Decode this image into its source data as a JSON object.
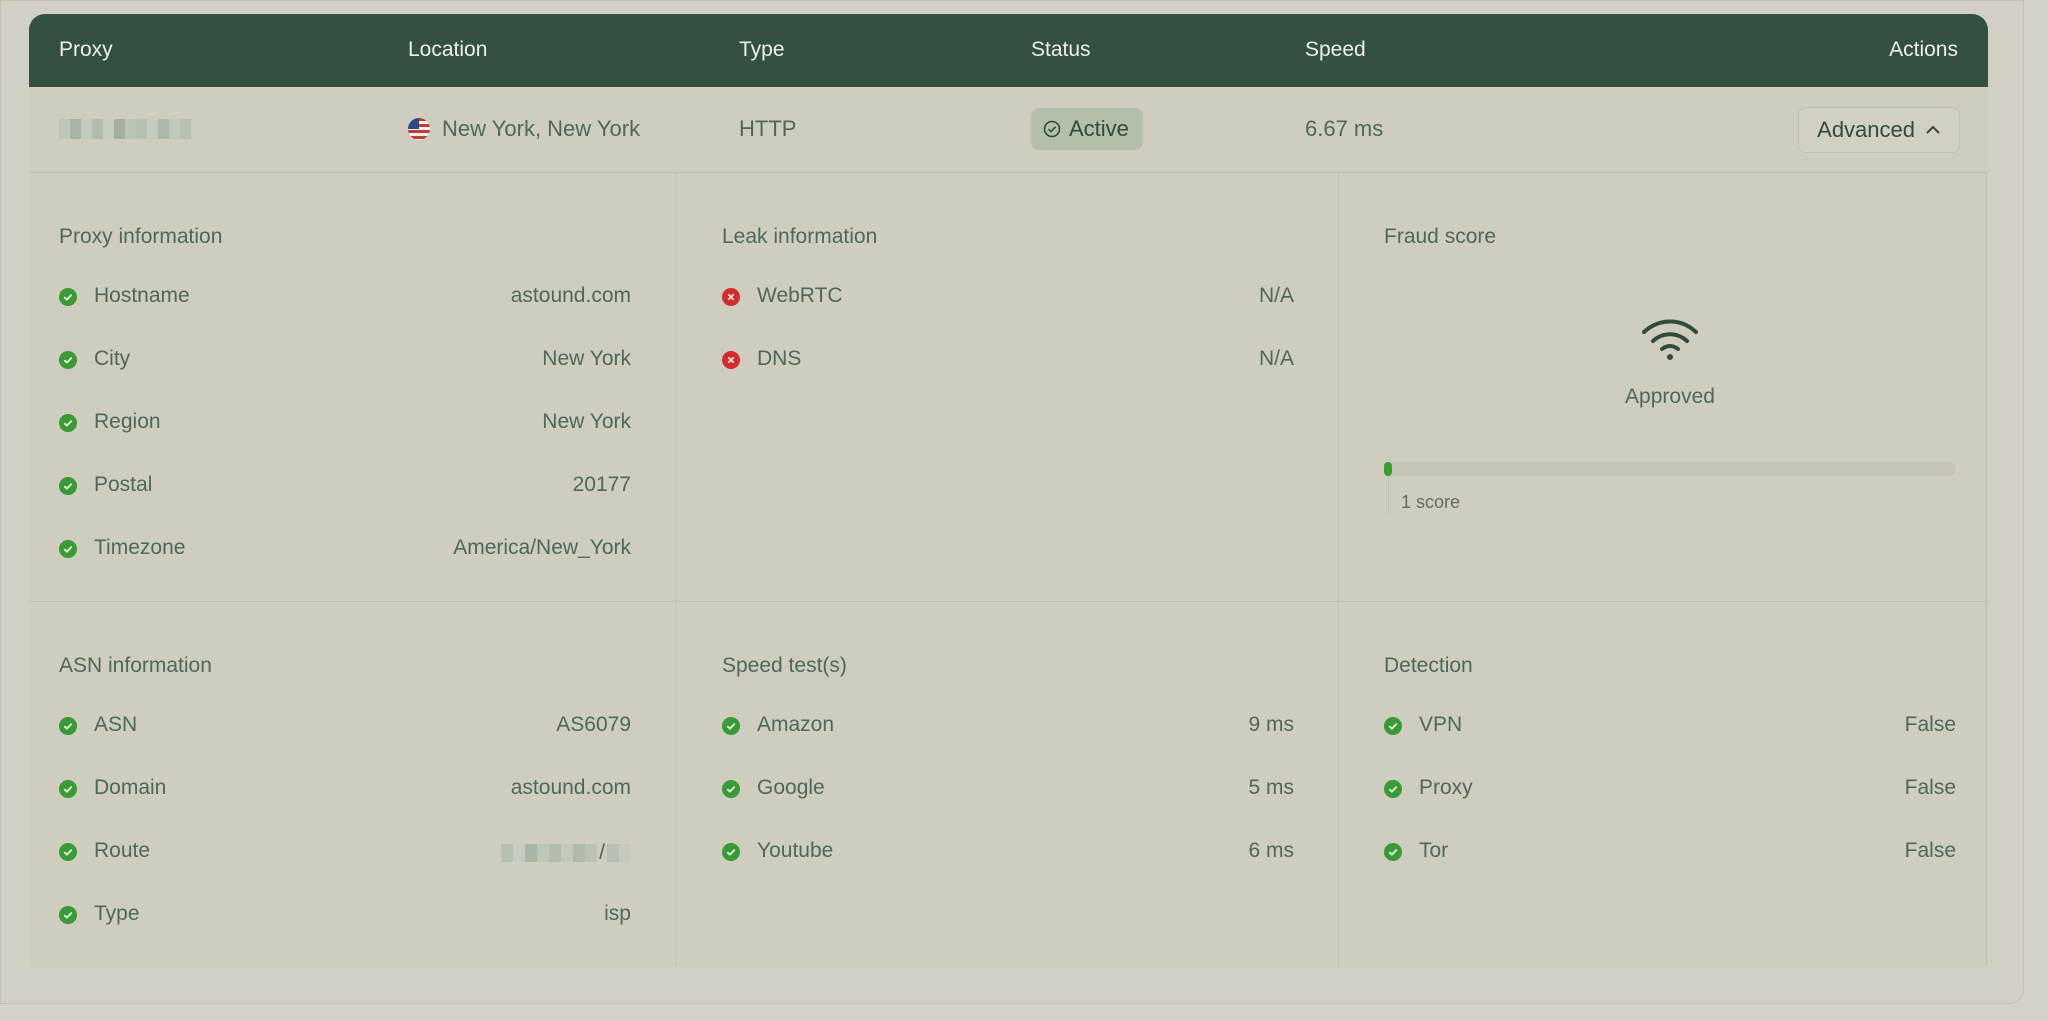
{
  "header": {
    "proxy": "Proxy",
    "location": "Location",
    "type": "Type",
    "status": "Status",
    "speed": "Speed",
    "actions": "Actions"
  },
  "row": {
    "location": "New York, New York",
    "type": "HTTP",
    "status": "Active",
    "speed": "6.67 ms",
    "advanced_label": "Advanced"
  },
  "proxy_info": {
    "title": "Proxy information",
    "items": [
      {
        "label": "Hostname",
        "value": "astound.com"
      },
      {
        "label": "City",
        "value": "New York"
      },
      {
        "label": "Region",
        "value": "New York"
      },
      {
        "label": "Postal",
        "value": "20177"
      },
      {
        "label": "Timezone",
        "value": "America/New_York"
      }
    ]
  },
  "leak_info": {
    "title": "Leak information",
    "items": [
      {
        "label": "WebRTC",
        "value": "N/A"
      },
      {
        "label": "DNS",
        "value": "N/A"
      }
    ]
  },
  "fraud": {
    "title": "Fraud score",
    "status": "Approved",
    "score_label": "1 score",
    "score_fraction": 0.01
  },
  "asn_info": {
    "title": "ASN information",
    "items": [
      {
        "label": "ASN",
        "value": "AS6079"
      },
      {
        "label": "Domain",
        "value": "astound.com"
      },
      {
        "label": "Route",
        "value": "/"
      },
      {
        "label": "Type",
        "value": "isp"
      }
    ]
  },
  "speed_tests": {
    "title": "Speed test(s)",
    "items": [
      {
        "label": "Amazon",
        "value": "9 ms"
      },
      {
        "label": "Google",
        "value": "5 ms"
      },
      {
        "label": "Youtube",
        "value": "6 ms"
      }
    ]
  },
  "detection": {
    "title": "Detection",
    "items": [
      {
        "label": "VPN",
        "value": "False"
      },
      {
        "label": "Proxy",
        "value": "False"
      },
      {
        "label": "Tor",
        "value": "False"
      }
    ]
  },
  "colors": {
    "header_bg": "#345040",
    "ok": "#3a9a36",
    "bad": "#cf2e2e",
    "badge_bg": "#b3bfa8"
  },
  "icons": {
    "ok": "check-circle-icon",
    "bad": "x-circle-icon",
    "status": "check-circle-outline-icon",
    "advanced": "chevron-up-icon",
    "fraud": "wifi-icon"
  }
}
